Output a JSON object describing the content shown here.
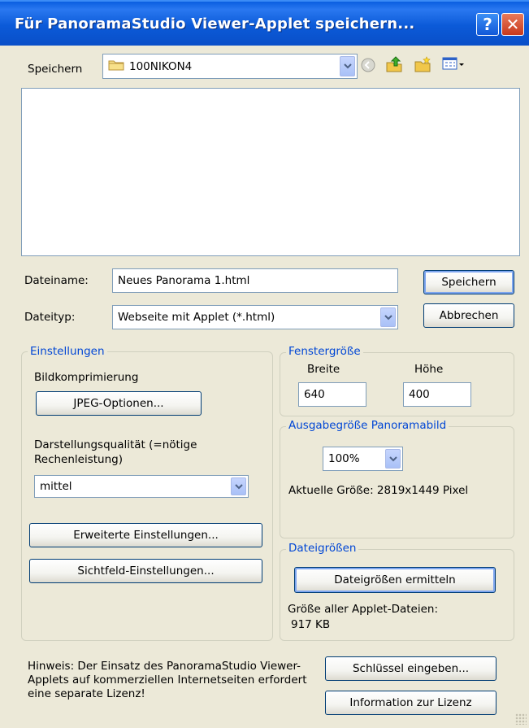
{
  "window": {
    "title": "Für PanoramaStudio Viewer-Applet speichern...",
    "help_glyph": "?",
    "close_glyph": "✕"
  },
  "savein": {
    "label": "Speichern",
    "folder": "100NIKON4",
    "icons": [
      "folder-icon",
      "back-icon",
      "up-folder-icon",
      "new-folder-icon",
      "view-menu-icon"
    ]
  },
  "filename": {
    "label": "Dateiname:",
    "value": "Neues Panorama 1.html"
  },
  "filetype": {
    "label": "Dateityp:",
    "value": "Webseite mit Applet (*.html)"
  },
  "buttons": {
    "save": "Speichern",
    "cancel": "Abbrechen",
    "jpeg": "JPEG-Optionen...",
    "advanced": "Erweiterte Einstellungen...",
    "fov": "Sichtfeld-Einstellungen...",
    "calc_sizes": "Dateigrößen ermitteln",
    "enter_key": "Schlüssel eingeben...",
    "license_info": "Information zur Lizenz"
  },
  "settings": {
    "legend": "Einstellungen",
    "compression_label": "Bildkomprimierung",
    "quality_label": "Darstellungsqualität (=nötige Rechenleistung)",
    "quality_value": "mittel"
  },
  "window_size": {
    "legend": "Fenstergröße",
    "width_label": "Breite",
    "height_label": "Höhe",
    "width_value": "640",
    "height_value": "400"
  },
  "output_size": {
    "legend": "Ausgabegröße Panoramabild",
    "percent": "100%",
    "current_size": "Aktuelle Größe: 2819x1449 Pixel"
  },
  "file_sizes": {
    "legend": "Dateigrößen",
    "total_label": "Größe aller Applet-Dateien:",
    "total_value": "917 KB"
  },
  "notice": "Hinweis: Der Einsatz des PanoramaStudio Viewer-Applets auf kommerziellen Internetseiten erfordert eine separate Lizenz!",
  "colors": {
    "titlebar": "#0a5ee0",
    "legend": "#0046d5",
    "face": "#ece9d8"
  }
}
